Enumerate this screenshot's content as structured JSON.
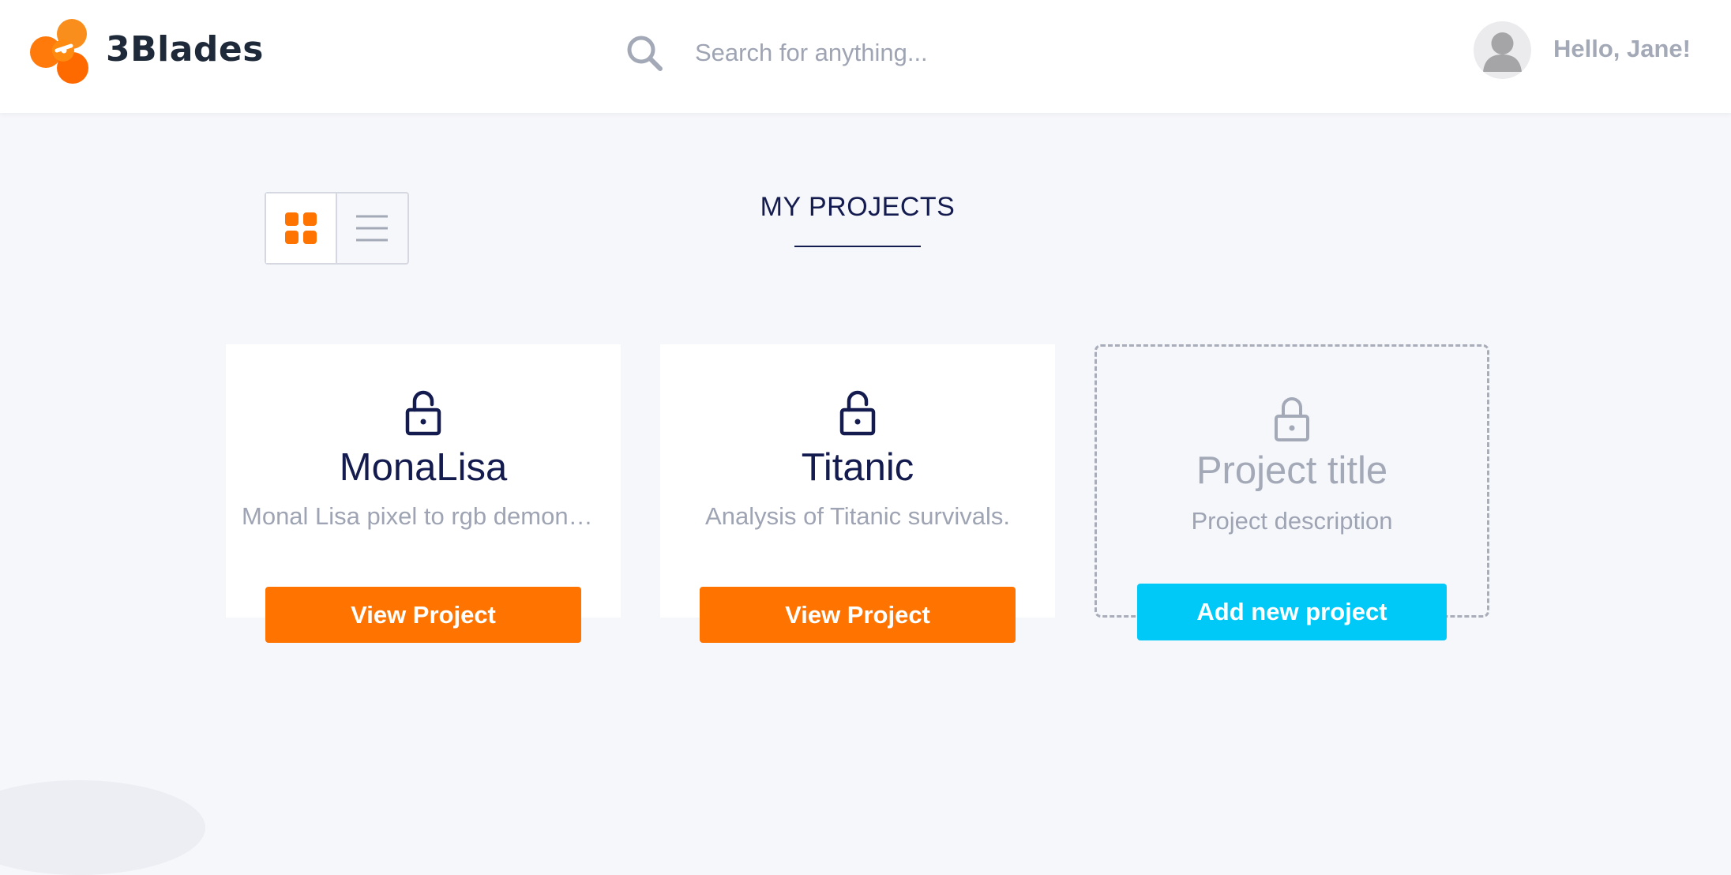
{
  "app": {
    "brand_name": "3Blades",
    "logo_icon": "three-blade-propeller-logo",
    "accent_color": "#ff7300",
    "secondary_color": "#00c9f8"
  },
  "header": {
    "search": {
      "icon": "search-icon",
      "placeholder": "Search for anything...",
      "value": ""
    },
    "user": {
      "avatar_icon": "user-avatar-icon",
      "greeting": "Hello, Jane!"
    }
  },
  "view_toggle": {
    "active": "grid",
    "grid_icon": "grid-view-icon",
    "list_icon": "list-view-icon"
  },
  "page": {
    "title": "MY PROJECTS"
  },
  "projects": [
    {
      "icon": "unlocked-icon",
      "title": "MonaLisa",
      "description": "Monal Lisa pixel to rgb demonstration",
      "button_label": "View Project"
    },
    {
      "icon": "unlocked-icon",
      "title": "Titanic",
      "description": "Analysis of Titanic survivals.",
      "button_label": "View Project"
    }
  ],
  "new_project": {
    "icon": "lock-icon",
    "title": "Project title",
    "description": "Project description",
    "button_label": "Add new project"
  }
}
